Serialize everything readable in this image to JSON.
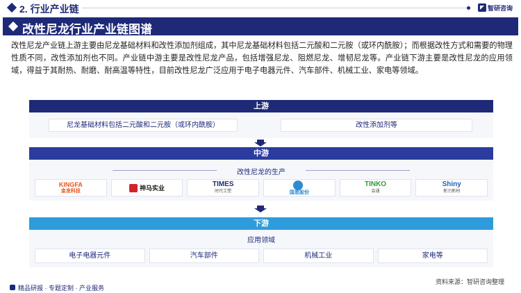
{
  "header": {
    "section_title": "2. 行业产业链",
    "logo_text": "智研咨询"
  },
  "title": "改性尼龙行业产业链图谱",
  "intro": "改性尼龙产业链上游主要由尼龙基础材料和改性添加剂组成，其中尼龙基础材料包括二元酸和二元胺（或环内酰胺）；而根据改性方式和需要的物理性质不同，改性添加剂也不同。产业链中游主要是改性尼龙产品，包括增强尼龙、阻燃尼龙、增韧尼龙等。产业链下游主要是改性尼龙的应用领域，得益于其耐热、耐磨、耐高温等特性，目前改性尼龙广泛应用于电子电器元件、汽车部件、机械工业、家电等领域。",
  "upstream": {
    "label": "上游",
    "items": [
      "尼龙基础材料包括二元酸和二元胺（或环内酰胺）",
      "改性添加剂等"
    ]
  },
  "midstream": {
    "label": "中游",
    "subtitle": "改性尼龙的生产",
    "logos": [
      {
        "name": "KINGFA",
        "sub": "金发科技"
      },
      {
        "name": "神马实业",
        "sub": ""
      },
      {
        "name": "TIMES",
        "sub": "时代工塑"
      },
      {
        "name": "",
        "sub": "国恩股份"
      },
      {
        "name": "TINKO",
        "sub": "会通"
      },
      {
        "name": "Shiny",
        "sub": "新力新材"
      }
    ]
  },
  "downstream": {
    "label": "下游",
    "subtitle": "应用领域",
    "items": [
      "电子电器元件",
      "汽车部件",
      "机械工业",
      "家电等"
    ]
  },
  "source": "资料来源：智研咨询整理",
  "footer": "精品研报 · 专题定制 · 产业服务",
  "colors": {
    "navy": "#1e2a78",
    "blue": "#2b3c9e",
    "sky": "#2e9bdc"
  }
}
